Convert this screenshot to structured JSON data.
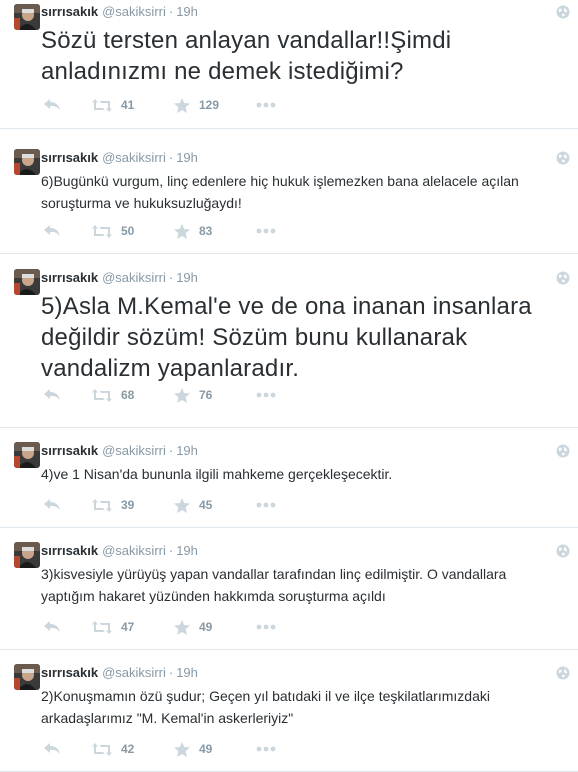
{
  "account": {
    "fullname": "sırrısakık",
    "username": "@sakiksirri"
  },
  "tweets": [
    {
      "time": "19h",
      "text": "Sözü tersten anlayan vandallar!!Şimdi anladınızmı ne demek istediğimi?",
      "retweets": "41",
      "favorites": "129"
    },
    {
      "time": "19h",
      "text": "6)Bugünkü vurgum, linç edenlere hiç hukuk işlemezken bana alelacele açılan soruşturma ve hukuksuzluğaydı!",
      "retweets": "50",
      "favorites": "83"
    },
    {
      "time": "19h",
      "text": "5)Asla M.Kemal'e ve de ona inanan insanlara değildir sözüm! Sözüm bunu kullanarak vandalizm yapanlaradır.",
      "retweets": "68",
      "favorites": "76"
    },
    {
      "time": "19h",
      "text": "4)ve 1 Nisan'da bununla ilgili mahkeme gerçekleşecektir.",
      "retweets": "39",
      "favorites": "45"
    },
    {
      "time": "19h",
      "text": "3)kisvesiyle yürüyüş yapan vandallar tarafından linç edilmiştir. O vandallara yaptığım hakaret yüzünden hakkımda soruşturma açıldı",
      "retweets": "47",
      "favorites": "49"
    },
    {
      "time": "19h",
      "text": "2)Konuşmamın özü şudur; Geçen yıl batıdaki il ve ilçe teşkilatlarımızdaki arkadaşlarımız \"M. Kemal'in askerleriyiz\"",
      "retweets": "42",
      "favorites": "49"
    }
  ],
  "icons": {
    "reply": "reply-icon",
    "retweet": "retweet-icon",
    "favorite": "star-icon",
    "more": "more-dots-icon",
    "follow": "follow-globe-icon"
  },
  "colors": {
    "text": "#292f33",
    "muted": "#8899a6",
    "icon": "#ccd6dd",
    "divider": "#e1e8ed"
  }
}
